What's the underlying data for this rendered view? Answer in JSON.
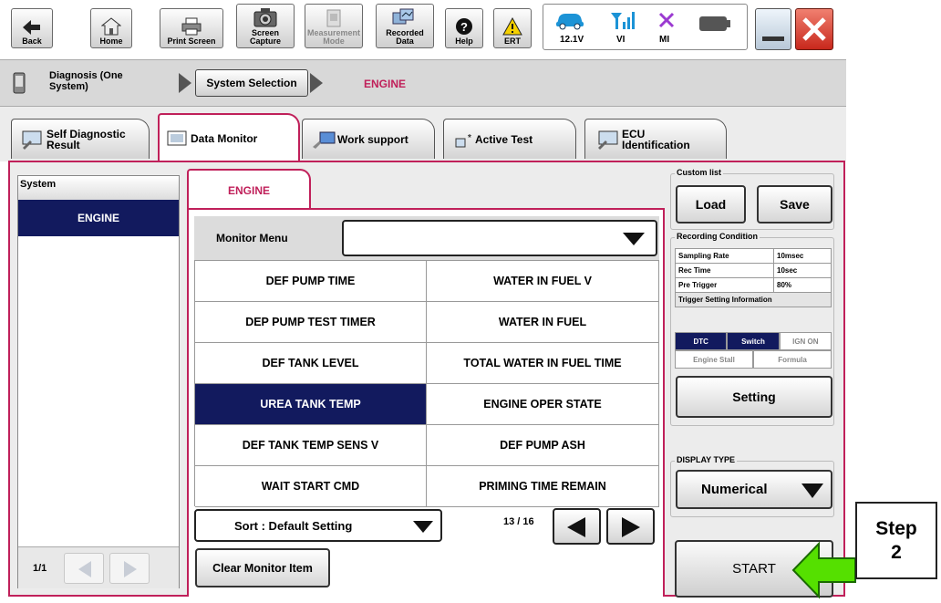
{
  "toolbar": {
    "back": "Back",
    "home": "Home",
    "print_screen": "Print Screen",
    "screen_capture": "Screen Capture",
    "measurement_mode": "Measurement Mode",
    "recorded_data": "Recorded Data",
    "help": "Help",
    "ert": "ERT",
    "voltage": "12.1V",
    "vi": "VI",
    "mi": "MI"
  },
  "breadcrumb": {
    "diagnosis": "Diagnosis (One System)",
    "system_selection": "System Selection",
    "current": "ENGINE"
  },
  "tabs": {
    "self_diag": "Self Diagnostic Result",
    "data_monitor": "Data Monitor",
    "work_support": "Work support",
    "active_test": "Active Test",
    "ecu_id": "ECU Identification"
  },
  "system_list": {
    "header": "System",
    "selected": "ENGINE",
    "page": "1/1"
  },
  "monitor": {
    "tab": "ENGINE",
    "menu_label": "Monitor Menu",
    "menu_value": "",
    "items": [
      [
        "DEF PUMP TIME",
        "WATER IN FUEL V"
      ],
      [
        "DEP PUMP TEST TIMER",
        "WATER IN FUEL"
      ],
      [
        "DEF TANK LEVEL",
        "TOTAL WATER IN FUEL TIME"
      ],
      [
        "UREA TANK TEMP",
        "ENGINE OPER STATE"
      ],
      [
        "DEF TANK TEMP SENS V",
        "DEF PUMP ASH"
      ],
      [
        "WAIT START CMD",
        "PRIMING TIME REMAIN"
      ]
    ],
    "selected_item": "UREA TANK TEMP",
    "sort": "Sort : Default Setting",
    "page": "13 / 16",
    "clear": "Clear Monitor Item"
  },
  "custom_list": {
    "title": "Custom list",
    "load": "Load",
    "save": "Save"
  },
  "recording": {
    "title": "Recording Condition",
    "rows": [
      {
        "label": "Sampling Rate",
        "value": "10msec"
      },
      {
        "label": "Rec Time",
        "value": "10sec"
      },
      {
        "label": "Pre Trigger",
        "value": "80%"
      }
    ],
    "trigger_header": "Trigger Setting Information",
    "trigger_row1": [
      "DTC",
      "Switch",
      "IGN ON"
    ],
    "trigger_row2": [
      "Engine Stall",
      "Formula"
    ],
    "setting": "Setting"
  },
  "display_type": {
    "title": "DISPLAY TYPE",
    "value": "Numerical"
  },
  "start": "START",
  "callout": {
    "line1": "Step",
    "line2": "2"
  },
  "colors": {
    "accent": "#c0205a",
    "selected": "#121a5e",
    "arrow": "#55e000"
  }
}
